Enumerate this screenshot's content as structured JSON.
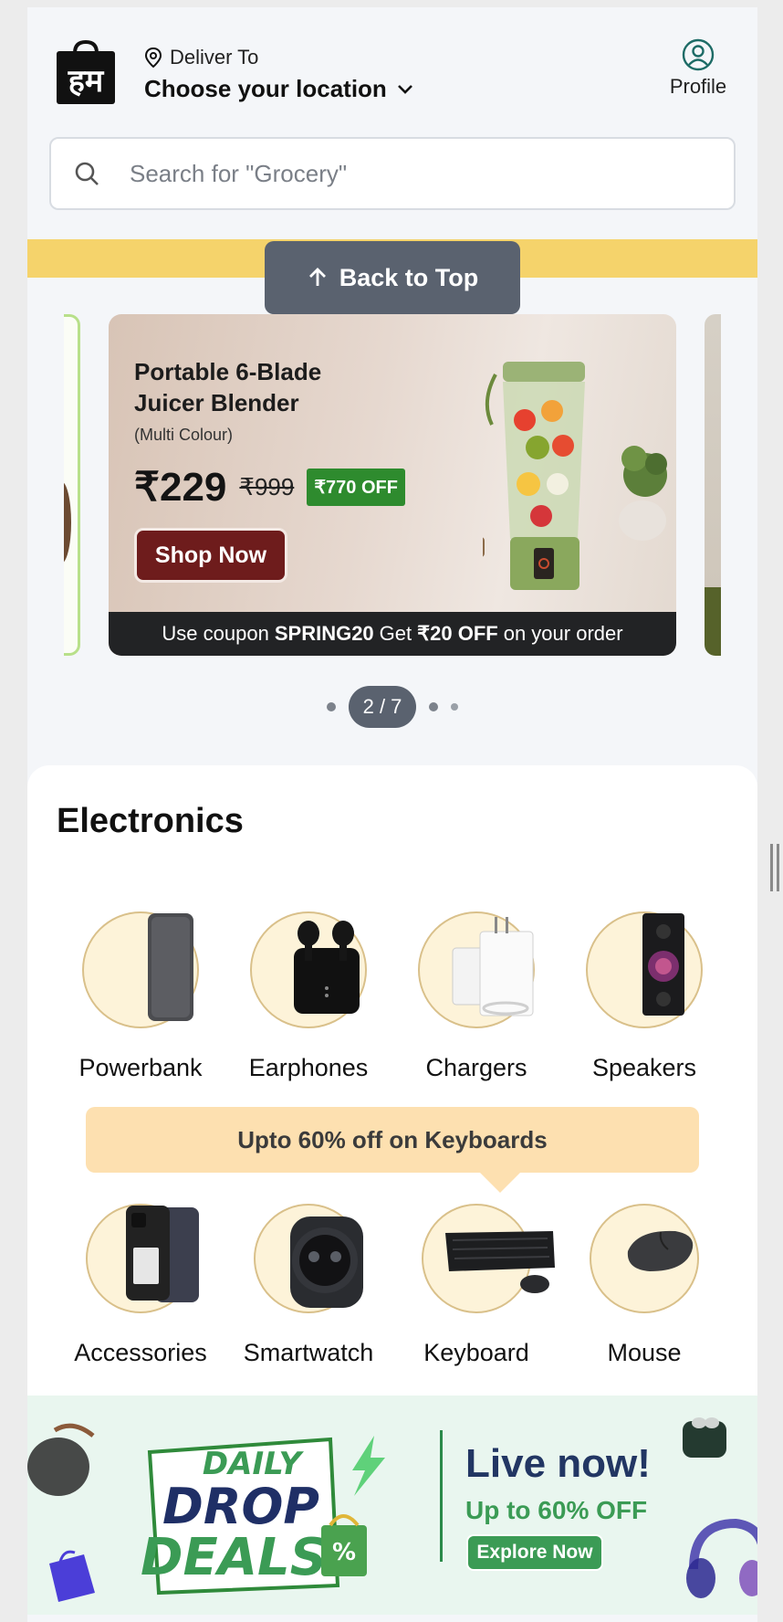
{
  "header": {
    "logo_text": "हम",
    "deliver_label": "Deliver To",
    "location_label": "Choose your location",
    "profile_label": "Profile"
  },
  "search": {
    "placeholder": "Search for \"Grocery\""
  },
  "back_to_top": {
    "label": "Back to Top"
  },
  "banner": {
    "title": "Portable 6-Blade Juicer Blender",
    "subtitle": "(Multi Colour)",
    "price": "₹229",
    "mrp": "₹999",
    "off_tag": "₹770 OFF",
    "shop_label": "Shop Now",
    "coupon_prefix": "Use coupon",
    "coupon_code": "SPRING20",
    "coupon_mid": "Get",
    "coupon_amount": "₹20 OFF",
    "coupon_suffix": "on your order",
    "bg_color": "#e6d8cf",
    "button_color": "#6e1c1c",
    "off_color": "#2e8b2e"
  },
  "pager": {
    "label": "2 / 7"
  },
  "electronics": {
    "title": "Electronics",
    "row1": [
      {
        "label": "Powerbank",
        "icon": "powerbank-icon"
      },
      {
        "label": "Earphones",
        "icon": "earphones-icon"
      },
      {
        "label": "Chargers",
        "icon": "charger-icon"
      },
      {
        "label": "Speakers",
        "icon": "speaker-icon"
      }
    ],
    "promo": "Upto 60% off on Keyboards",
    "row2": [
      {
        "label": "Accessories",
        "icon": "phone-case-icon"
      },
      {
        "label": "Smartwatch",
        "icon": "smartwatch-icon"
      },
      {
        "label": "Keyboard",
        "icon": "keyboard-icon"
      },
      {
        "label": "Mouse",
        "icon": "mouse-icon"
      }
    ],
    "circle_color": "#fdf3d9",
    "promo_color": "#fde0b0"
  },
  "deals": {
    "badge_line1": "DAILY",
    "badge_line2": "DROP",
    "badge_line3": "DEALS",
    "badge_pct": "%",
    "live": "Live now!",
    "upto": "Up to 60% OFF",
    "explore": "Explore Now",
    "bg_color": "#e9f6ef",
    "accent": "#3b9b55",
    "navy": "#223663"
  }
}
